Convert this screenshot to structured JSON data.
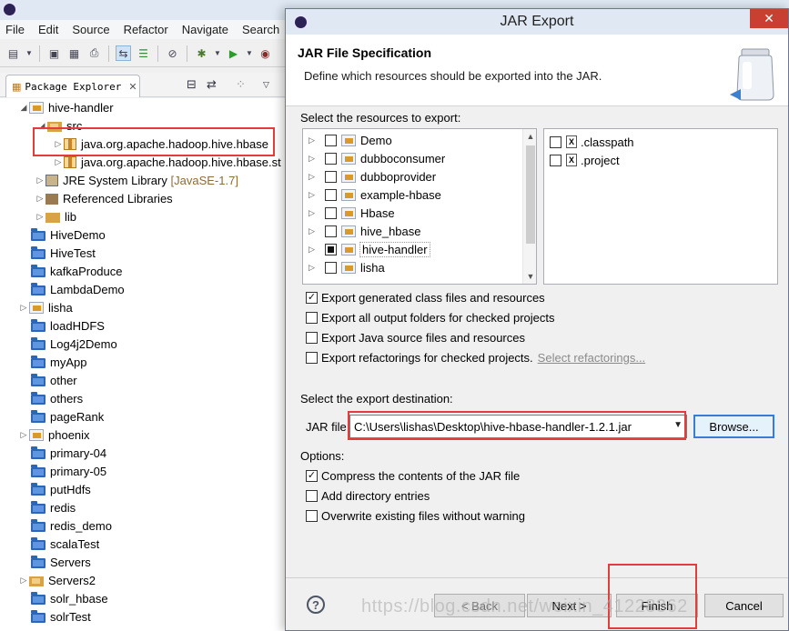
{
  "eclipse": {
    "menu": [
      "File",
      "Edit",
      "Source",
      "Refactor",
      "Navigate",
      "Search"
    ],
    "package_explorer": {
      "tab_title": "Package Explorer",
      "tree": [
        {
          "label": "hive-handler",
          "kind": "project",
          "expanded": true
        },
        {
          "label": "src",
          "kind": "source-folder",
          "expanded": true
        },
        {
          "label": "java.org.apache.hadoop.hive.hbase",
          "kind": "package"
        },
        {
          "label": "java.org.apache.hadoop.hive.hbase.st",
          "kind": "package"
        },
        {
          "label": "JRE System Library",
          "suffix": "[JavaSE-1.7]",
          "kind": "library"
        },
        {
          "label": "Referenced Libraries",
          "kind": "library"
        },
        {
          "label": "lib",
          "kind": "folder"
        },
        {
          "label": "HiveDemo",
          "kind": "folder"
        },
        {
          "label": "HiveTest",
          "kind": "folder"
        },
        {
          "label": "kafkaProduce",
          "kind": "folder"
        },
        {
          "label": "LambdaDemo",
          "kind": "folder"
        },
        {
          "label": "lisha",
          "kind": "project"
        },
        {
          "label": "loadHDFS",
          "kind": "folder"
        },
        {
          "label": "Log4j2Demo",
          "kind": "folder"
        },
        {
          "label": "myApp",
          "kind": "folder"
        },
        {
          "label": "other",
          "kind": "folder"
        },
        {
          "label": "others",
          "kind": "folder"
        },
        {
          "label": "pageRank",
          "kind": "folder"
        },
        {
          "label": "phoenix",
          "kind": "project"
        },
        {
          "label": "primary-04",
          "kind": "folder"
        },
        {
          "label": "primary-05",
          "kind": "folder"
        },
        {
          "label": "putHdfs",
          "kind": "folder"
        },
        {
          "label": "redis",
          "kind": "folder"
        },
        {
          "label": "redis_demo",
          "kind": "folder"
        },
        {
          "label": "scalaTest",
          "kind": "folder"
        },
        {
          "label": "Servers",
          "kind": "folder"
        },
        {
          "label": "Servers2",
          "kind": "folder"
        },
        {
          "label": "solr_hbase",
          "kind": "folder"
        },
        {
          "label": "solrTest",
          "kind": "folder"
        }
      ]
    }
  },
  "dialog": {
    "title": "JAR Export",
    "close_icon": "✕",
    "heading": "JAR File Specification",
    "description": "Define which resources should be exported into the JAR.",
    "resources_label": "Select the resources to export:",
    "resource_tree": [
      {
        "label": "Demo",
        "state": "unchecked"
      },
      {
        "label": "dubboconsumer",
        "state": "unchecked"
      },
      {
        "label": "dubboprovider",
        "state": "unchecked"
      },
      {
        "label": "example-hbase",
        "state": "unchecked"
      },
      {
        "label": "Hbase",
        "state": "unchecked"
      },
      {
        "label": "hive_hbase",
        "state": "unchecked"
      },
      {
        "label": "hive-handler",
        "state": "partial"
      },
      {
        "label": "lisha",
        "state": "unchecked"
      }
    ],
    "file_list": [
      {
        "label": ".classpath",
        "checked": false
      },
      {
        "label": ".project",
        "checked": false
      }
    ],
    "export_options": [
      {
        "label": "Export generated class files and resources",
        "checked": true
      },
      {
        "label": "Export all output folders for checked projects",
        "checked": false
      },
      {
        "label": "Export Java source files and resources",
        "checked": false
      },
      {
        "label": "Export refactorings for checked projects.",
        "checked": false
      }
    ],
    "select_refactorings_link": "Select refactorings...",
    "destination_label": "Select the export destination:",
    "jar_file_label": "JAR file:",
    "jar_file_value": "C:\\Users\\lishas\\Desktop\\hive-hbase-handler-1.2.1.jar",
    "browse_label": "Browse...",
    "options_label": "Options:",
    "options": [
      {
        "label": "Compress the contents of the JAR file",
        "checked": true
      },
      {
        "label": "Add directory entries",
        "checked": false
      },
      {
        "label": "Overwrite existing files without warning",
        "checked": false
      }
    ],
    "buttons": {
      "help": "?",
      "back": "< Back",
      "next": "Next >",
      "finish": "Finish",
      "cancel": "Cancel"
    }
  },
  "watermark": "https://blog.csdn.net/weixin_41228362"
}
